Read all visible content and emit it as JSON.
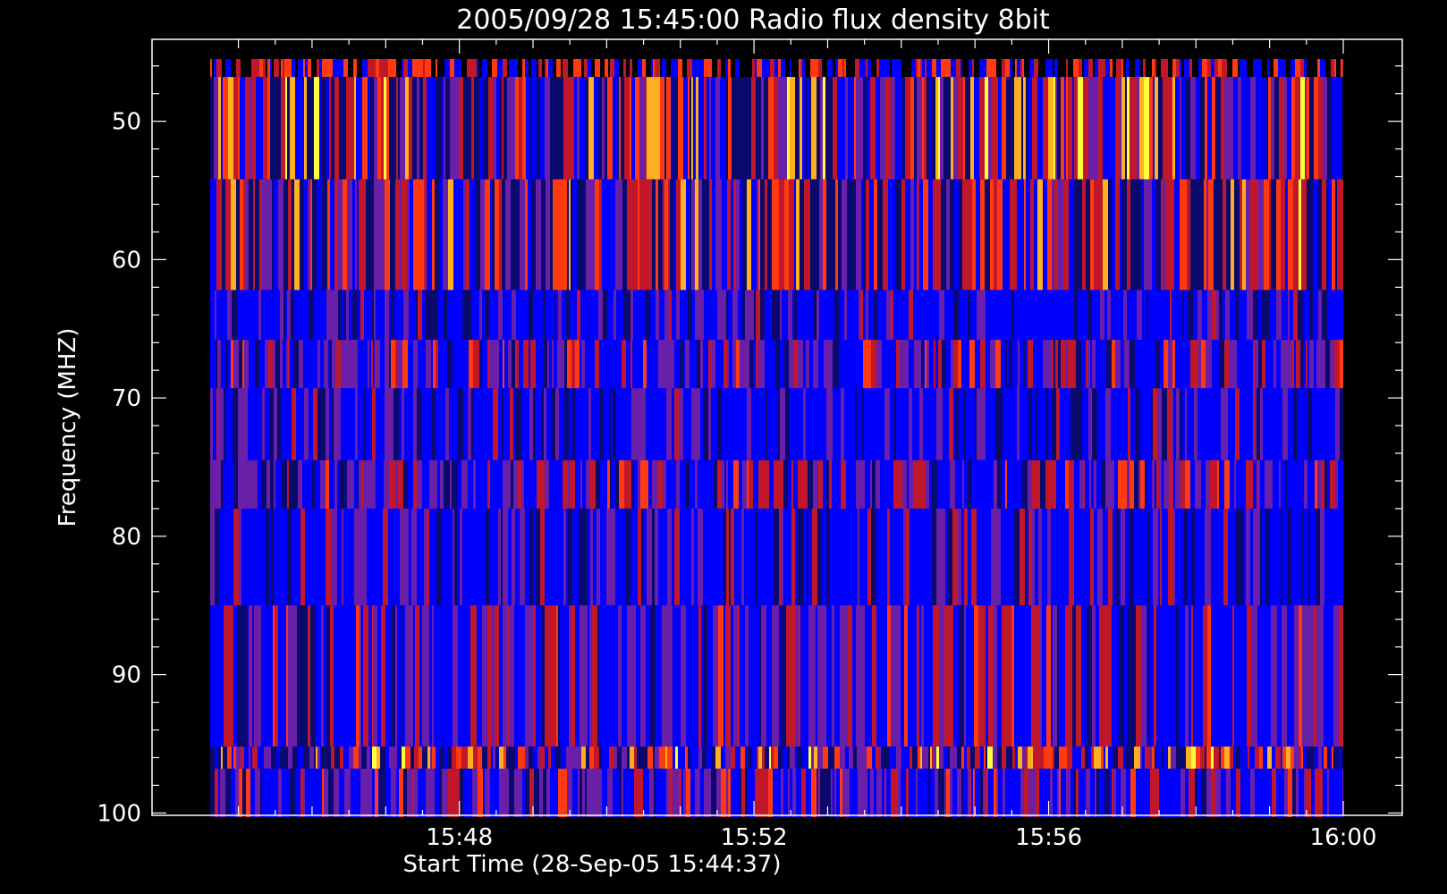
{
  "chart_data": {
    "type": "heatmap",
    "title": "2005/09/28 15:45:00 Radio flux density 8bit",
    "xlabel": "Start Time (28-Sep-05 15:44:37)",
    "ylabel": "Frequency (MHZ)",
    "x_range": [
      "15:44:37",
      "16:00:00"
    ],
    "ylim": [
      100.3,
      45.5
    ],
    "y_ticks": [
      50,
      60,
      70,
      80,
      90,
      100
    ],
    "x_ticks": [
      "15:48",
      "15:52",
      "15:56",
      "16:00"
    ],
    "colormap": [
      "#000000",
      "#0a0a6e",
      "#0000ff",
      "#6a1fa8",
      "#c0182a",
      "#ff3a10",
      "#ffb020",
      "#ffff40"
    ],
    "bands": [
      {
        "freq_from": 45.5,
        "freq_to": 46.8,
        "level": "mixed-high"
      },
      {
        "freq_from": 46.8,
        "freq_to": 54.2,
        "level": "high"
      },
      {
        "freq_from": 54.2,
        "freq_to": 62.2,
        "level": "high"
      },
      {
        "freq_from": 62.2,
        "freq_to": 65.8,
        "level": "low"
      },
      {
        "freq_from": 65.8,
        "freq_to": 69.3,
        "level": "medium"
      },
      {
        "freq_from": 69.3,
        "freq_to": 74.5,
        "level": "low"
      },
      {
        "freq_from": 74.5,
        "freq_to": 78.0,
        "level": "medium"
      },
      {
        "freq_from": 78.0,
        "freq_to": 85.0,
        "level": "low"
      },
      {
        "freq_from": 85.0,
        "freq_to": 95.2,
        "level": "medium"
      },
      {
        "freq_from": 95.2,
        "freq_to": 96.8,
        "level": "high"
      },
      {
        "freq_from": 96.8,
        "freq_to": 100.3,
        "level": "medium"
      }
    ]
  }
}
